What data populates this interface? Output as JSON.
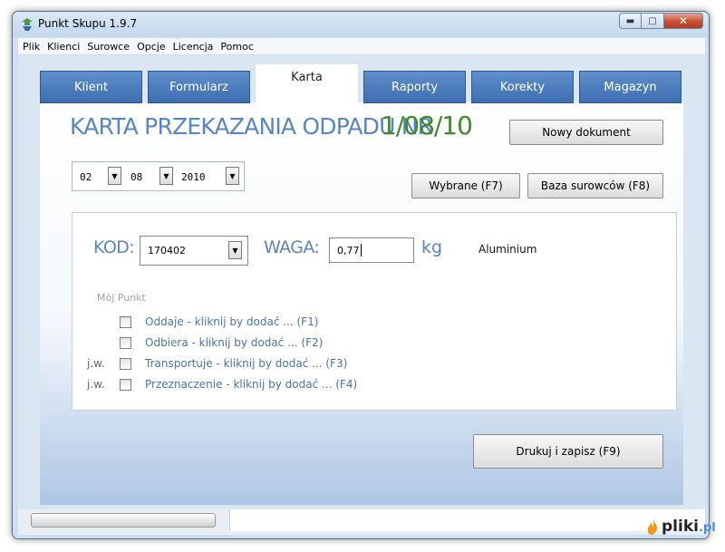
{
  "window": {
    "title": "Punkt Skupu 1.9.7"
  },
  "menu": [
    "Plik",
    "Klienci",
    "Surowce",
    "Opcje",
    "Licencja",
    "Pomoc"
  ],
  "tabs": [
    {
      "label": "Klient",
      "active": false
    },
    {
      "label": "Formularz",
      "active": false
    },
    {
      "label": "Karta",
      "active": true
    },
    {
      "label": "Raporty",
      "active": false
    },
    {
      "label": "Korekty",
      "active": false
    },
    {
      "label": "Magazyn",
      "active": false
    }
  ],
  "document": {
    "title": "KARTA PRZEKAZANIA ODPADU NR",
    "number": "1/08/10"
  },
  "buttons": {
    "new_document": "Nowy dokument",
    "selected": "Wybrane (F7)",
    "materials_db": "Baza surowców (F8)",
    "print_save": "Drukuj i zapisz (F9)"
  },
  "date": {
    "day": "02",
    "month": "08",
    "year": "2010"
  },
  "form": {
    "kod_label": "KOD:",
    "kod_value": "170402",
    "waga_label": "WAGA:",
    "waga_value": "0,77",
    "unit": "kg",
    "material": "Aluminium"
  },
  "section_label": "Mój Punkt",
  "checks": [
    {
      "prefix": "",
      "label": "Oddaje - kliknij by dodać ... (F1)",
      "checked": false
    },
    {
      "prefix": "",
      "label": "Odbiera - kliknij by dodać ... (F2)",
      "checked": false
    },
    {
      "prefix": "j.w.",
      "label": "Transportuje - kliknij by dodać ... (F3)",
      "checked": false
    },
    {
      "prefix": "j.w.",
      "label": "Przeznaczenie - kliknij by dodać ... (F4)",
      "checked": false
    }
  ],
  "watermark": {
    "name": "pliki",
    "suffix": ".pl"
  },
  "colors": {
    "accent_blue": "#5b86bd",
    "doc_number_green": "#3e8a2c",
    "tab_blue": "#4a7ac0",
    "link_blue": "#4a74aa"
  }
}
